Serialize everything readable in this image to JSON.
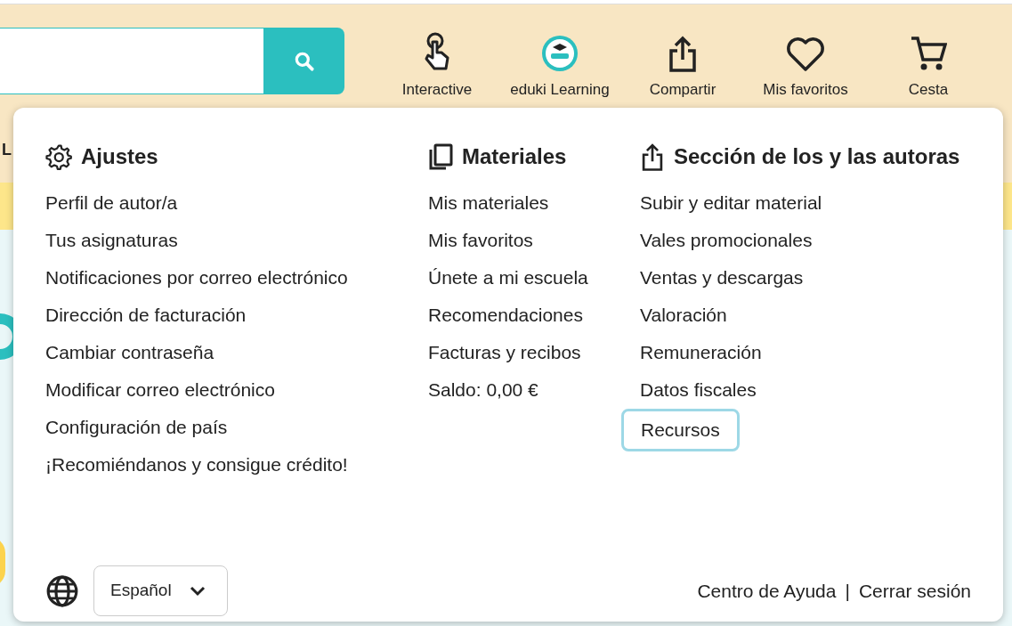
{
  "header": {
    "nav": [
      {
        "kind": "touch",
        "label": "Interactive"
      },
      {
        "kind": "logo",
        "label": "eduki Learning"
      },
      {
        "kind": "share",
        "label": "Compartir"
      },
      {
        "kind": "heart",
        "label": "Mis favoritos"
      },
      {
        "kind": "cart",
        "label": "Cesta"
      }
    ]
  },
  "background_fragments": [
    "L"
  ],
  "menu": {
    "columns": [
      {
        "kind": "gear",
        "title": "Ajustes",
        "items": [
          {
            "label": "Perfil de autor/a",
            "focused": false
          },
          {
            "label": "Tus asignaturas",
            "focused": false
          },
          {
            "label": "Notificaciones por correo electrónico",
            "focused": false
          },
          {
            "label": "Dirección de facturación",
            "focused": false
          },
          {
            "label": "Cambiar contraseña",
            "focused": false
          },
          {
            "label": "Modificar correo electrónico",
            "focused": false
          },
          {
            "label": "Configuración de país",
            "focused": false
          },
          {
            "label": "¡Recomiéndanos y consigue crédito!",
            "focused": false
          }
        ]
      },
      {
        "kind": "copy",
        "title": "Materiales",
        "items": [
          {
            "label": "Mis materiales",
            "focused": false
          },
          {
            "label": "Mis favoritos",
            "focused": false
          },
          {
            "label": "Únete a mi escuela",
            "focused": false
          },
          {
            "label": "Recomendaciones",
            "focused": false
          },
          {
            "label": "Facturas y recibos",
            "focused": false
          },
          {
            "label": "Saldo: 0,00 €",
            "focused": false
          }
        ]
      },
      {
        "kind": "share",
        "title": "Sección de los y las autoras",
        "items": [
          {
            "label": "Subir y editar material",
            "focused": false
          },
          {
            "label": "Vales promocionales",
            "focused": false
          },
          {
            "label": "Ventas y descargas",
            "focused": false
          },
          {
            "label": "Valoración",
            "focused": false
          },
          {
            "label": "Remuneración",
            "focused": false
          },
          {
            "label": "Datos fiscales",
            "focused": false
          },
          {
            "label": "Recursos",
            "focused": true
          }
        ]
      }
    ],
    "language": "Español",
    "footer_links": [
      "Centro de Ayuda",
      "Cerrar sesión"
    ],
    "separator": "|"
  }
}
